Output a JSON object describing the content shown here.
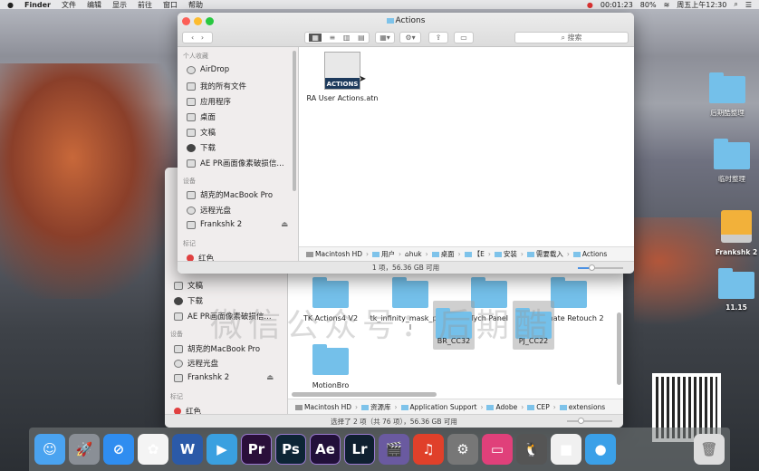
{
  "menubar": {
    "app": "Finder",
    "items": [
      "文件",
      "编辑",
      "显示",
      "前往",
      "窗口",
      "帮助"
    ],
    "recording_time": "00:01:23",
    "battery": "80%",
    "clock": "周五上午12:30"
  },
  "front_window": {
    "title": "Actions",
    "search_placeholder": "搜索",
    "sidebar": {
      "favorites_header": "个人收藏",
      "favorites": [
        "AirDrop",
        "我的所有文件",
        "应用程序",
        "桌面",
        "文稿",
        "下载",
        "AE PR画面像素破损信..."
      ],
      "devices_header": "设备",
      "devices": [
        "胡克的MacBook Pro",
        "远程光盘",
        "Frankshk 2"
      ],
      "tags_header": "标记",
      "tags": [
        "红色"
      ]
    },
    "files": [
      {
        "name": "RA User Actions.atn",
        "icon_label": "ACTIONS"
      }
    ],
    "path": [
      "Macintosh HD",
      "用户",
      "huk",
      "桌面",
      "【E",
      "安装",
      "需要载入",
      "Actions"
    ],
    "status": "1 项，56.36 GB 可用",
    "icon_size_fraction": 0.25
  },
  "back_window": {
    "sidebar": {
      "favorites": [
        "文稿",
        "下载",
        "AE PR画面像素破损信..."
      ],
      "devices_header": "设备",
      "devices": [
        "胡克的MacBook Pro",
        "远程光盘",
        "Frankshk 2"
      ],
      "tags_header": "标记",
      "tags": [
        "红色"
      ]
    },
    "folders": [
      "TK Actions4 V2",
      "tk_infinity_mask_panel",
      "Tych Panel",
      "Ultimate Retouch 2",
      "MotionBro"
    ],
    "dragged": [
      "BR_CC32",
      "PJ_CC22"
    ],
    "path": [
      "Macintosh HD",
      "资源库",
      "Application Support",
      "Adobe",
      "CEP",
      "extensions"
    ],
    "status": "选择了 2 项（共 76 项），56.36 GB 可用",
    "icon_size_fraction": 0.25
  },
  "desktop": [
    "后期酷整理",
    "临时整理",
    "Frankshk 2",
    "11.15"
  ],
  "watermark": "微信公众号：后期酷",
  "dock": [
    {
      "name": "finder",
      "label": "☺",
      "color": "#4aa3f0"
    },
    {
      "name": "launchpad",
      "label": "🚀",
      "color": "#8a8f96"
    },
    {
      "name": "safari",
      "label": "⊘",
      "color": "#2f8df0"
    },
    {
      "name": "photos",
      "label": "✿",
      "color": "#f4f4f4"
    },
    {
      "name": "word",
      "label": "W",
      "color": "#2b5aa8"
    },
    {
      "name": "video-player",
      "label": "▶",
      "color": "#3aa0e0"
    },
    {
      "name": "premiere",
      "label": "Pr",
      "color": "#2a0f3a"
    },
    {
      "name": "photoshop",
      "label": "Ps",
      "color": "#0d2535"
    },
    {
      "name": "after-effects",
      "label": "Ae",
      "color": "#22103a"
    },
    {
      "name": "lightroom",
      "label": "Lr",
      "color": "#0f2030"
    },
    {
      "name": "final-cut",
      "label": "🎬",
      "color": "#6a5aa0"
    },
    {
      "name": "netease-music",
      "label": "♫",
      "color": "#e0402a"
    },
    {
      "name": "system-preferences",
      "label": "⚙",
      "color": "#777"
    },
    {
      "name": "clean-my-mac",
      "label": "▭",
      "color": "#e0407a"
    },
    {
      "name": "qq",
      "label": "🐧",
      "color": "#555"
    },
    {
      "name": "facetime",
      "label": "■",
      "color": "#f0f0f0"
    },
    {
      "name": "zoom-meeting",
      "label": "●",
      "color": "#3aa0e8"
    }
  ],
  "colors": {
    "folder": "#74c0ea",
    "close": "#fc5f57",
    "minimize": "#fdbc2e",
    "zoom": "#28c840"
  }
}
